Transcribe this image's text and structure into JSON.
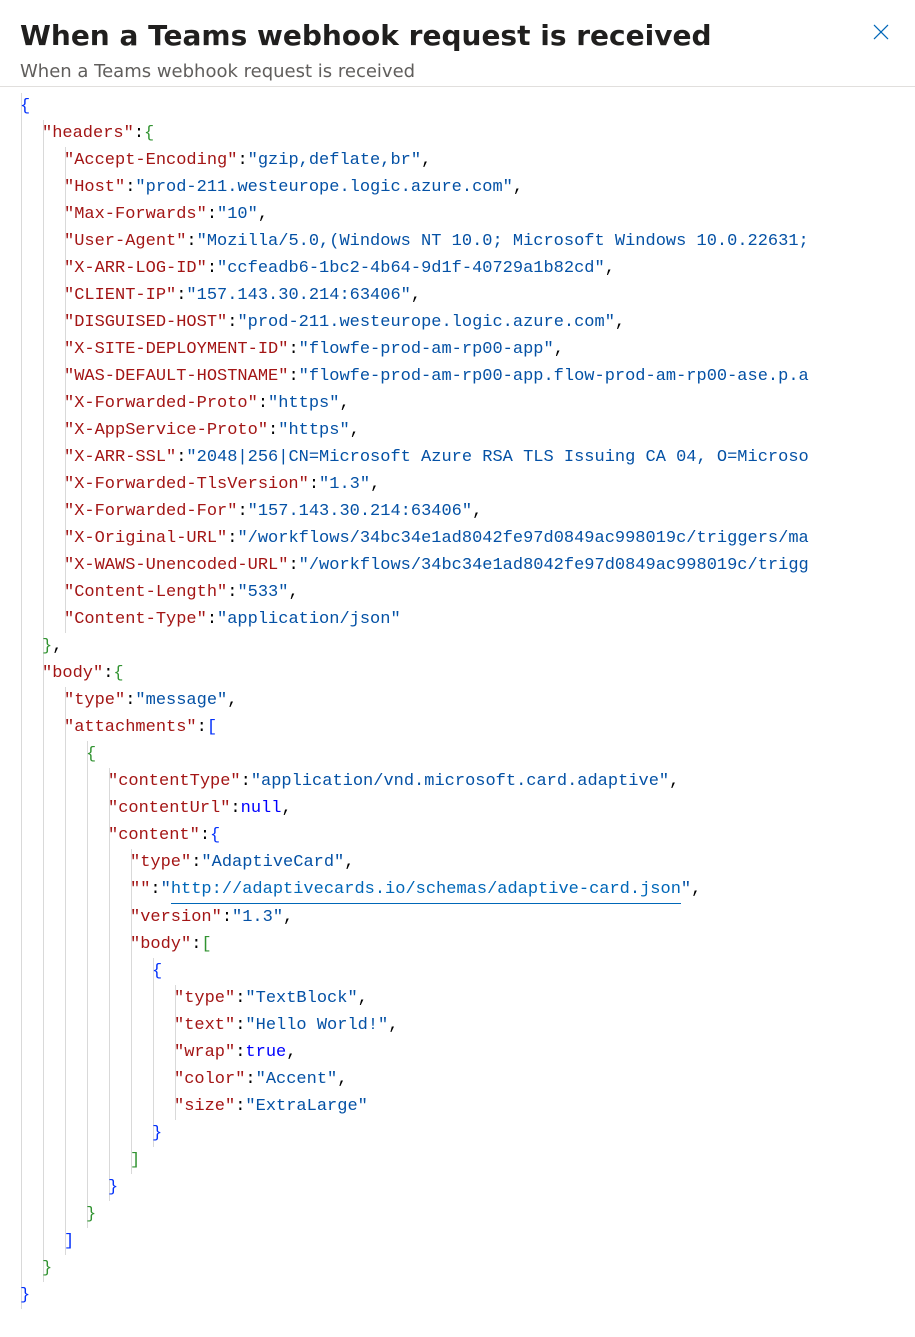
{
  "panel": {
    "title": "When a Teams webhook request is received",
    "subtitle": "When a Teams webhook request is received"
  },
  "lines": [
    {
      "indent": 0,
      "guides": [
        0
      ],
      "tokens": [
        {
          "t": "{",
          "c": "brace-blue"
        }
      ]
    },
    {
      "indent": 2,
      "guides": [
        0,
        2
      ],
      "tokens": [
        {
          "t": "\"headers\"",
          "c": "key"
        },
        {
          "t": ": ",
          "c": "punct"
        },
        {
          "t": "{",
          "c": "brace-green"
        }
      ]
    },
    {
      "indent": 4,
      "guides": [
        0,
        2,
        4
      ],
      "tokens": [
        {
          "t": "\"Accept-Encoding\"",
          "c": "key"
        },
        {
          "t": ": ",
          "c": "punct"
        },
        {
          "t": "\"gzip,deflate,br\"",
          "c": "str"
        },
        {
          "t": ",",
          "c": "punct"
        }
      ]
    },
    {
      "indent": 4,
      "guides": [
        0,
        2,
        4
      ],
      "tokens": [
        {
          "t": "\"Host\"",
          "c": "key"
        },
        {
          "t": ": ",
          "c": "punct"
        },
        {
          "t": "\"prod-211.westeurope.logic.azure.com\"",
          "c": "str"
        },
        {
          "t": ",",
          "c": "punct"
        }
      ]
    },
    {
      "indent": 4,
      "guides": [
        0,
        2,
        4
      ],
      "tokens": [
        {
          "t": "\"Max-Forwards\"",
          "c": "key"
        },
        {
          "t": ": ",
          "c": "punct"
        },
        {
          "t": "\"10\"",
          "c": "str"
        },
        {
          "t": ",",
          "c": "punct"
        }
      ]
    },
    {
      "indent": 4,
      "guides": [
        0,
        2,
        4
      ],
      "tokens": [
        {
          "t": "\"User-Agent\"",
          "c": "key"
        },
        {
          "t": ": ",
          "c": "punct"
        },
        {
          "t": "\"Mozilla/5.0,(Windows NT 10.0; Microsoft Windows 10.0.22631;",
          "c": "str"
        }
      ]
    },
    {
      "indent": 4,
      "guides": [
        0,
        2,
        4
      ],
      "tokens": [
        {
          "t": "\"X-ARR-LOG-ID\"",
          "c": "key"
        },
        {
          "t": ": ",
          "c": "punct"
        },
        {
          "t": "\"ccfeadb6-1bc2-4b64-9d1f-40729a1b82cd\"",
          "c": "str"
        },
        {
          "t": ",",
          "c": "punct"
        }
      ]
    },
    {
      "indent": 4,
      "guides": [
        0,
        2,
        4
      ],
      "tokens": [
        {
          "t": "\"CLIENT-IP\"",
          "c": "key"
        },
        {
          "t": ": ",
          "c": "punct"
        },
        {
          "t": "\"157.143.30.214:63406\"",
          "c": "str"
        },
        {
          "t": ",",
          "c": "punct"
        }
      ]
    },
    {
      "indent": 4,
      "guides": [
        0,
        2,
        4
      ],
      "tokens": [
        {
          "t": "\"DISGUISED-HOST\"",
          "c": "key"
        },
        {
          "t": ": ",
          "c": "punct"
        },
        {
          "t": "\"prod-211.westeurope.logic.azure.com\"",
          "c": "str"
        },
        {
          "t": ",",
          "c": "punct"
        }
      ]
    },
    {
      "indent": 4,
      "guides": [
        0,
        2,
        4
      ],
      "tokens": [
        {
          "t": "\"X-SITE-DEPLOYMENT-ID\"",
          "c": "key"
        },
        {
          "t": ": ",
          "c": "punct"
        },
        {
          "t": "\"flowfe-prod-am-rp00-app\"",
          "c": "str"
        },
        {
          "t": ",",
          "c": "punct"
        }
      ]
    },
    {
      "indent": 4,
      "guides": [
        0,
        2,
        4
      ],
      "tokens": [
        {
          "t": "\"WAS-DEFAULT-HOSTNAME\"",
          "c": "key"
        },
        {
          "t": ": ",
          "c": "punct"
        },
        {
          "t": "\"flowfe-prod-am-rp00-app.flow-prod-am-rp00-ase.p.a",
          "c": "str"
        }
      ]
    },
    {
      "indent": 4,
      "guides": [
        0,
        2,
        4
      ],
      "tokens": [
        {
          "t": "\"X-Forwarded-Proto\"",
          "c": "key"
        },
        {
          "t": ": ",
          "c": "punct"
        },
        {
          "t": "\"https\"",
          "c": "str"
        },
        {
          "t": ",",
          "c": "punct"
        }
      ]
    },
    {
      "indent": 4,
      "guides": [
        0,
        2,
        4
      ],
      "tokens": [
        {
          "t": "\"X-AppService-Proto\"",
          "c": "key"
        },
        {
          "t": ": ",
          "c": "punct"
        },
        {
          "t": "\"https\"",
          "c": "str"
        },
        {
          "t": ",",
          "c": "punct"
        }
      ]
    },
    {
      "indent": 4,
      "guides": [
        0,
        2,
        4
      ],
      "tokens": [
        {
          "t": "\"X-ARR-SSL\"",
          "c": "key"
        },
        {
          "t": ": ",
          "c": "punct"
        },
        {
          "t": "\"2048|256|CN=Microsoft Azure RSA TLS Issuing CA 04, O=Microso",
          "c": "str"
        }
      ]
    },
    {
      "indent": 4,
      "guides": [
        0,
        2,
        4
      ],
      "tokens": [
        {
          "t": "\"X-Forwarded-TlsVersion\"",
          "c": "key"
        },
        {
          "t": ": ",
          "c": "punct"
        },
        {
          "t": "\"1.3\"",
          "c": "str"
        },
        {
          "t": ",",
          "c": "punct"
        }
      ]
    },
    {
      "indent": 4,
      "guides": [
        0,
        2,
        4
      ],
      "tokens": [
        {
          "t": "\"X-Forwarded-For\"",
          "c": "key"
        },
        {
          "t": ": ",
          "c": "punct"
        },
        {
          "t": "\"157.143.30.214:63406\"",
          "c": "str"
        },
        {
          "t": ",",
          "c": "punct"
        }
      ]
    },
    {
      "indent": 4,
      "guides": [
        0,
        2,
        4
      ],
      "tokens": [
        {
          "t": "\"X-Original-URL\"",
          "c": "key"
        },
        {
          "t": ": ",
          "c": "punct"
        },
        {
          "t": "\"/workflows/34bc34e1ad8042fe97d0849ac998019c/triggers/ma",
          "c": "str"
        }
      ]
    },
    {
      "indent": 4,
      "guides": [
        0,
        2,
        4
      ],
      "tokens": [
        {
          "t": "\"X-WAWS-Unencoded-URL\"",
          "c": "key"
        },
        {
          "t": ": ",
          "c": "punct"
        },
        {
          "t": "\"/workflows/34bc34e1ad8042fe97d0849ac998019c/trigg",
          "c": "str"
        }
      ]
    },
    {
      "indent": 4,
      "guides": [
        0,
        2,
        4
      ],
      "tokens": [
        {
          "t": "\"Content-Length\"",
          "c": "key"
        },
        {
          "t": ": ",
          "c": "punct"
        },
        {
          "t": "\"533\"",
          "c": "str"
        },
        {
          "t": ",",
          "c": "punct"
        }
      ]
    },
    {
      "indent": 4,
      "guides": [
        0,
        2,
        4
      ],
      "tokens": [
        {
          "t": "\"Content-Type\"",
          "c": "key"
        },
        {
          "t": ": ",
          "c": "punct"
        },
        {
          "t": "\"application/json\"",
          "c": "str"
        }
      ]
    },
    {
      "indent": 2,
      "guides": [
        0,
        2
      ],
      "tokens": [
        {
          "t": "}",
          "c": "brace-green"
        },
        {
          "t": ",",
          "c": "punct"
        }
      ]
    },
    {
      "indent": 2,
      "guides": [
        0,
        2
      ],
      "tokens": [
        {
          "t": "\"body\"",
          "c": "key"
        },
        {
          "t": ": ",
          "c": "punct"
        },
        {
          "t": "{",
          "c": "brace-green"
        }
      ]
    },
    {
      "indent": 4,
      "guides": [
        0,
        2,
        4
      ],
      "tokens": [
        {
          "t": "\"type\"",
          "c": "key"
        },
        {
          "t": ": ",
          "c": "punct"
        },
        {
          "t": "\"message\"",
          "c": "str"
        },
        {
          "t": ",",
          "c": "punct"
        }
      ]
    },
    {
      "indent": 4,
      "guides": [
        0,
        2,
        4
      ],
      "tokens": [
        {
          "t": "\"attachments\"",
          "c": "key"
        },
        {
          "t": ": ",
          "c": "punct"
        },
        {
          "t": "[",
          "c": "brace-blue"
        }
      ]
    },
    {
      "indent": 6,
      "guides": [
        0,
        2,
        4,
        6
      ],
      "tokens": [
        {
          "t": "{",
          "c": "brace-green"
        }
      ]
    },
    {
      "indent": 8,
      "guides": [
        0,
        2,
        4,
        6,
        8
      ],
      "tokens": [
        {
          "t": "\"contentType\"",
          "c": "key"
        },
        {
          "t": ": ",
          "c": "punct"
        },
        {
          "t": "\"application/vnd.microsoft.card.adaptive\"",
          "c": "str"
        },
        {
          "t": ",",
          "c": "punct"
        }
      ]
    },
    {
      "indent": 8,
      "guides": [
        0,
        2,
        4,
        6,
        8
      ],
      "tokens": [
        {
          "t": "\"contentUrl\"",
          "c": "key"
        },
        {
          "t": ": ",
          "c": "punct"
        },
        {
          "t": "null",
          "c": "null"
        },
        {
          "t": ",",
          "c": "punct"
        }
      ]
    },
    {
      "indent": 8,
      "guides": [
        0,
        2,
        4,
        6,
        8
      ],
      "tokens": [
        {
          "t": "\"content\"",
          "c": "key"
        },
        {
          "t": ": ",
          "c": "punct"
        },
        {
          "t": "{",
          "c": "brace-blue"
        }
      ]
    },
    {
      "indent": 10,
      "guides": [
        0,
        2,
        4,
        6,
        8,
        10
      ],
      "tokens": [
        {
          "t": "\"type\"",
          "c": "key"
        },
        {
          "t": ": ",
          "c": "punct"
        },
        {
          "t": "\"AdaptiveCard\"",
          "c": "str"
        },
        {
          "t": ",",
          "c": "punct"
        }
      ]
    },
    {
      "indent": 10,
      "guides": [
        0,
        2,
        4,
        6,
        8,
        10
      ],
      "tokens": [
        {
          "t": "\"\"",
          "c": "key"
        },
        {
          "t": ": ",
          "c": "punct"
        },
        {
          "t": "\"",
          "c": "str"
        },
        {
          "t": "http://adaptivecards.io/schemas/adaptive-card.json",
          "c": "link"
        },
        {
          "t": "\"",
          "c": "str"
        },
        {
          "t": ",",
          "c": "punct"
        }
      ]
    },
    {
      "indent": 10,
      "guides": [
        0,
        2,
        4,
        6,
        8,
        10
      ],
      "tokens": [
        {
          "t": "\"version\"",
          "c": "key"
        },
        {
          "t": ": ",
          "c": "punct"
        },
        {
          "t": "\"1.3\"",
          "c": "str"
        },
        {
          "t": ",",
          "c": "punct"
        }
      ]
    },
    {
      "indent": 10,
      "guides": [
        0,
        2,
        4,
        6,
        8,
        10
      ],
      "tokens": [
        {
          "t": "\"body\"",
          "c": "key"
        },
        {
          "t": ": ",
          "c": "punct"
        },
        {
          "t": "[",
          "c": "brace-green"
        }
      ]
    },
    {
      "indent": 12,
      "guides": [
        0,
        2,
        4,
        6,
        8,
        10,
        12
      ],
      "tokens": [
        {
          "t": "{",
          "c": "brace-blue"
        }
      ]
    },
    {
      "indent": 14,
      "guides": [
        0,
        2,
        4,
        6,
        8,
        10,
        12,
        14
      ],
      "tokens": [
        {
          "t": "\"type\"",
          "c": "key"
        },
        {
          "t": ": ",
          "c": "punct"
        },
        {
          "t": "\"TextBlock\"",
          "c": "str"
        },
        {
          "t": ",",
          "c": "punct"
        }
      ]
    },
    {
      "indent": 14,
      "guides": [
        0,
        2,
        4,
        6,
        8,
        10,
        12,
        14
      ],
      "tokens": [
        {
          "t": "\"text\"",
          "c": "key"
        },
        {
          "t": ": ",
          "c": "punct"
        },
        {
          "t": "\"Hello World!\"",
          "c": "str"
        },
        {
          "t": ",",
          "c": "punct"
        }
      ]
    },
    {
      "indent": 14,
      "guides": [
        0,
        2,
        4,
        6,
        8,
        10,
        12,
        14
      ],
      "tokens": [
        {
          "t": "\"wrap\"",
          "c": "key"
        },
        {
          "t": ": ",
          "c": "punct"
        },
        {
          "t": "true",
          "c": "bool"
        },
        {
          "t": ",",
          "c": "punct"
        }
      ]
    },
    {
      "indent": 14,
      "guides": [
        0,
        2,
        4,
        6,
        8,
        10,
        12,
        14
      ],
      "tokens": [
        {
          "t": "\"color\"",
          "c": "key"
        },
        {
          "t": ": ",
          "c": "punct"
        },
        {
          "t": "\"Accent\"",
          "c": "str"
        },
        {
          "t": ",",
          "c": "punct"
        }
      ]
    },
    {
      "indent": 14,
      "guides": [
        0,
        2,
        4,
        6,
        8,
        10,
        12,
        14
      ],
      "tokens": [
        {
          "t": "\"size\"",
          "c": "key"
        },
        {
          "t": ": ",
          "c": "punct"
        },
        {
          "t": "\"ExtraLarge\"",
          "c": "str"
        }
      ]
    },
    {
      "indent": 12,
      "guides": [
        0,
        2,
        4,
        6,
        8,
        10,
        12
      ],
      "tokens": [
        {
          "t": "}",
          "c": "brace-blue"
        }
      ]
    },
    {
      "indent": 10,
      "guides": [
        0,
        2,
        4,
        6,
        8,
        10
      ],
      "tokens": [
        {
          "t": "]",
          "c": "brace-green"
        }
      ]
    },
    {
      "indent": 8,
      "guides": [
        0,
        2,
        4,
        6,
        8
      ],
      "tokens": [
        {
          "t": "}",
          "c": "brace-blue"
        }
      ]
    },
    {
      "indent": 6,
      "guides": [
        0,
        2,
        4,
        6
      ],
      "tokens": [
        {
          "t": "}",
          "c": "brace-green"
        }
      ]
    },
    {
      "indent": 4,
      "guides": [
        0,
        2,
        4
      ],
      "tokens": [
        {
          "t": "]",
          "c": "brace-blue"
        }
      ]
    },
    {
      "indent": 2,
      "guides": [
        0,
        2
      ],
      "tokens": [
        {
          "t": "}",
          "c": "brace-green"
        }
      ]
    },
    {
      "indent": 0,
      "guides": [
        0
      ],
      "tokens": [
        {
          "t": "}",
          "c": "brace-blue"
        }
      ]
    }
  ]
}
